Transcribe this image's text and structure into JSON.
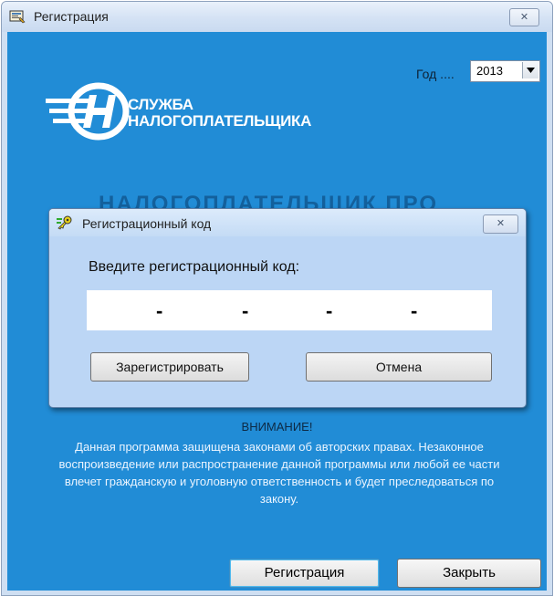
{
  "window": {
    "title": "Регистрация",
    "close_glyph": "✕",
    "icon": "app-window-icon"
  },
  "year": {
    "label": "Год ....",
    "value": "2013",
    "arrow_icon": "chevron-down-icon"
  },
  "brand": {
    "line1": "СЛУЖБА",
    "line2": "НАЛОГОПЛАТЕЛЬЩИКА",
    "product": "НАЛОГОПЛАТЕЛЬЩИК ПРО",
    "logo_icon": "service-logo-icon"
  },
  "dialog": {
    "title": "Регистрационный код",
    "close_glyph": "✕",
    "icon": "key-icon",
    "prompt": "Введите регистрационный код:",
    "code_dashes": [
      "-",
      "-",
      "-",
      "-"
    ],
    "register_label": "Зарегистрировать",
    "cancel_label": "Отмена"
  },
  "warning": {
    "title": "ВНИМАНИЕ!",
    "text": "Данная программа защищена законами об авторских правах. Незаконное воспроизведение или распространение данной программы или любой ее части влечет гражданскую и уголовную ответственность и будет преследоваться по закону."
  },
  "buttons": {
    "registration_label": "Регистрация",
    "close_label": "Закрыть"
  },
  "colors": {
    "background_blue": "#218cd6",
    "dialog_bg": "#bcd6f5",
    "brand_text": "#ffffff"
  }
}
